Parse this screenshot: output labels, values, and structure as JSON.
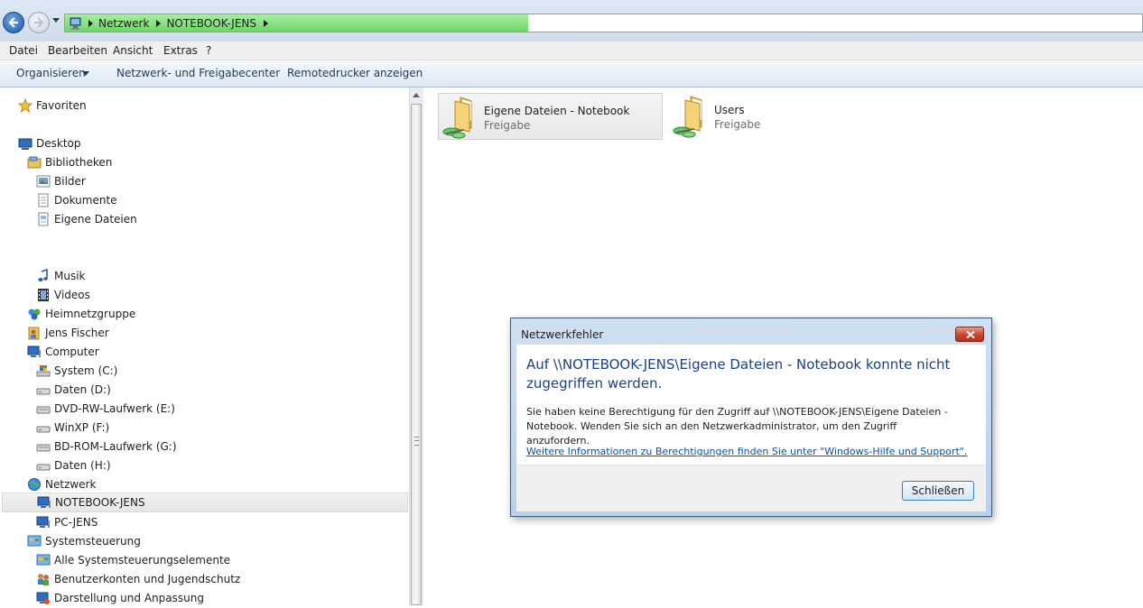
{
  "address_bar": {
    "crumbs": [
      "Netzwerk",
      "NOTEBOOK-JENS"
    ],
    "progress_fraction": 0.43
  },
  "menubar": {
    "items": [
      "Datei",
      "Bearbeiten",
      "Ansicht",
      "Extras",
      "?"
    ]
  },
  "commandbar": {
    "items": [
      "Organisieren",
      "Netzwerk- und Freigabecenter",
      "Remotedrucker anzeigen"
    ]
  },
  "navigation": {
    "items": [
      {
        "label": "Favoriten",
        "icon": "star-icon"
      },
      {
        "label": "Desktop",
        "icon": "desktop-icon"
      },
      {
        "label": "Bibliotheken",
        "icon": "libraries-icon"
      },
      {
        "label": "Bilder",
        "icon": "pictures-icon"
      },
      {
        "label": "Dokumente",
        "icon": "documents-icon"
      },
      {
        "label": "Eigene Dateien",
        "icon": "documents-icon"
      },
      {
        "label": "Musik",
        "icon": "music-icon"
      },
      {
        "label": "Videos",
        "icon": "video-icon"
      },
      {
        "label": "Heimnetzgruppe",
        "icon": "homegroup-icon"
      },
      {
        "label": "Jens Fischer",
        "icon": "user-folder-icon"
      },
      {
        "label": "Computer",
        "icon": "computer-icon"
      },
      {
        "label": "System (C:)",
        "icon": "system-drive-icon"
      },
      {
        "label": "Daten (D:)",
        "icon": "drive-icon"
      },
      {
        "label": "DVD-RW-Laufwerk (E:)",
        "icon": "dvd-drive-icon"
      },
      {
        "label": "WinXP (F:)",
        "icon": "drive-icon"
      },
      {
        "label": "BD-ROM-Laufwerk (G:)",
        "icon": "dvd-drive-icon"
      },
      {
        "label": "Daten (H:)",
        "icon": "drive-icon"
      },
      {
        "label": "Netzwerk",
        "icon": "network-icon"
      },
      {
        "label": "NOTEBOOK-JENS",
        "icon": "computer-icon",
        "selected": true
      },
      {
        "label": "PC-JENS",
        "icon": "computer-icon"
      },
      {
        "label": "Systemsteuerung",
        "icon": "control-panel-icon"
      },
      {
        "label": "Alle Systemsteuerungselemente",
        "icon": "control-panel-icon"
      },
      {
        "label": "Benutzerkonten und Jugendschutz",
        "icon": "users-icon"
      },
      {
        "label": "Darstellung und Anpassung",
        "icon": "display-icon"
      }
    ]
  },
  "shares": [
    {
      "name": "Eigene Dateien - Notebook",
      "type": "Freigabe"
    },
    {
      "name": "Users",
      "type": "Freigabe"
    }
  ],
  "dialog": {
    "title": "Netzwerkfehler",
    "main_instruction": "Auf \\\\NOTEBOOK-JENS\\Eigene Dateien - Notebook konnte nicht zugegriffen werden.",
    "description": "Sie haben keine Berechtigung für den Zugriff auf \\\\NOTEBOOK-JENS\\Eigene Dateien - Notebook. Wenden Sie sich an den Netzwerkadministrator, um den Zugriff anzufordern.",
    "link": "Weitere Informationen zu Berechtigungen finden Sie unter \"Windows-Hilfe und Support\".",
    "close_button": "Schließen"
  },
  "colors": {
    "accent_blue": "#1a3f8f",
    "link_blue": "#0b4fb2",
    "close_red": "#c9452c",
    "progress_green": "#6fd46a"
  }
}
